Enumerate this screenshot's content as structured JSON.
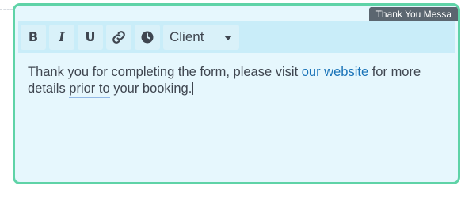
{
  "tag_badge": "Thank You Messa",
  "toolbar": {
    "buttons": [
      {
        "icon": "bold-icon",
        "glyph": "B"
      },
      {
        "icon": "italic-icon",
        "glyph": "I"
      },
      {
        "icon": "underline-icon",
        "glyph": "U"
      },
      {
        "icon": "link-icon"
      },
      {
        "icon": "clock-icon"
      }
    ],
    "select_value": "Client"
  },
  "editor": {
    "text_before_link": "Thank you for completing the form, please visit ",
    "link_text": "our website",
    "text_after_link": " for more details ",
    "flagged_text": "prior to",
    "text_end": " your booking."
  },
  "colors": {
    "frame_border": "#5fd3a7",
    "editor_bg": "#e6f7fd",
    "toolbar_bg": "#c9edf9",
    "link": "#1a73b8",
    "badge_bg": "#5b6670"
  }
}
